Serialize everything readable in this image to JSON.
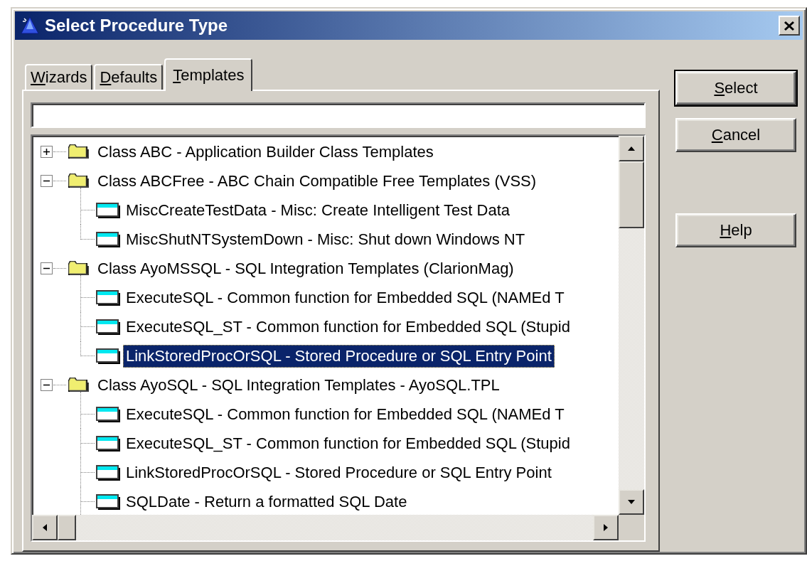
{
  "window": {
    "title": "Select Procedure Type"
  },
  "tabs": [
    {
      "label": "Wizards",
      "selected": false
    },
    {
      "label": "Defaults",
      "selected": false
    },
    {
      "label": "Templates",
      "selected": true
    }
  ],
  "tree": {
    "items": [
      {
        "kind": "folder",
        "label": "Class ABC - Application Builder Class Templates",
        "expanded": false,
        "selected": false
      },
      {
        "kind": "folder",
        "label": "Class ABCFree - ABC Chain Compatible Free Templates (VSS)",
        "expanded": true,
        "selected": false,
        "children": [
          {
            "kind": "procedure",
            "label": "MiscCreateTestData - Misc: Create Intelligent Test Data",
            "selected": false
          },
          {
            "kind": "procedure",
            "label": "MiscShutNTSystemDown - Misc: Shut down Windows NT",
            "selected": false
          }
        ]
      },
      {
        "kind": "folder",
        "label": "Class AyoMSSQL - SQL Integration Templates (ClarionMag)",
        "expanded": true,
        "selected": false,
        "children": [
          {
            "kind": "procedure",
            "label": "ExecuteSQL - Common function for Embedded SQL (NAMEd T",
            "selected": false
          },
          {
            "kind": "procedure",
            "label": "ExecuteSQL_ST - Common function for Embedded SQL (Stupid",
            "selected": false
          },
          {
            "kind": "procedure",
            "label": "LinkStoredProcOrSQL - Stored Procedure or SQL Entry Point",
            "selected": true
          }
        ]
      },
      {
        "kind": "folder",
        "label": "Class AyoSQL - SQL Integration Templates - AyoSQL.TPL",
        "expanded": true,
        "selected": false,
        "children": [
          {
            "kind": "procedure",
            "label": "ExecuteSQL - Common function for Embedded SQL (NAMEd T",
            "selected": false
          },
          {
            "kind": "procedure",
            "label": "ExecuteSQL_ST - Common function for Embedded SQL (Stupid",
            "selected": false
          },
          {
            "kind": "procedure",
            "label": "LinkStoredProcOrSQL - Stored Procedure or SQL Entry Point",
            "selected": false
          },
          {
            "kind": "procedure",
            "label": "SQLDate - Return a formatted SQL Date",
            "selected": false
          }
        ]
      }
    ]
  },
  "buttons": [
    {
      "label": "Select",
      "default": true
    },
    {
      "label": "Cancel",
      "default": false
    },
    {
      "label": "Help",
      "default": false
    }
  ]
}
